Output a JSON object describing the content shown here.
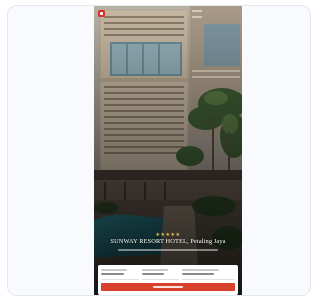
{
  "hotel": {
    "rating_stars": "★★★★★",
    "name": "SUNWAY RESORT HOTEL, Petaling Jaya"
  },
  "colors": {
    "brand": "#d3332a",
    "cta": "#d9402e",
    "stars": "#e8c25a"
  },
  "icons": {
    "brand": "brand-logo-icon"
  }
}
